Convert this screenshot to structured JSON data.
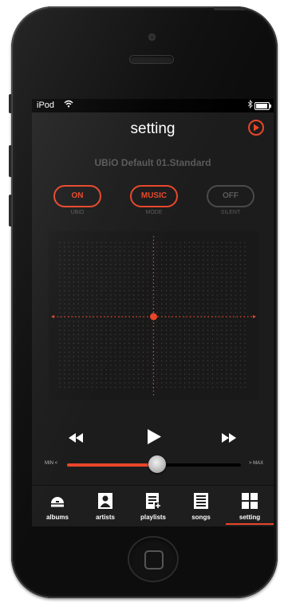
{
  "status_bar": {
    "carrier": "iPod",
    "wifi_icon": "wifi-icon",
    "bluetooth_icon": "bluetooth-icon",
    "battery_icon": "battery-icon",
    "battery_level": 0.9
  },
  "header": {
    "title": "setting",
    "play_icon": "play-circle-icon"
  },
  "preset": {
    "name": "UBiO Default 01.Standard"
  },
  "toggles": [
    {
      "label": "ON",
      "caption": "UBiO",
      "state": "active"
    },
    {
      "label": "MUSIC",
      "caption": "MODE",
      "state": "active"
    },
    {
      "label": "OFF",
      "caption": "SILENT",
      "state": "inactive"
    }
  ],
  "equalizer": {
    "x_value": 0,
    "y_value": 0,
    "grid_dots": "dotted",
    "axis_color": "#e8462a",
    "point_color": "#e8462a"
  },
  "transport": {
    "rewind_icon": "rewind-icon",
    "play_icon": "play-icon",
    "forward_icon": "fast-forward-icon"
  },
  "volume": {
    "min_label": "MIN <",
    "max_label": "> MAX",
    "level": 0.52
  },
  "tabs": [
    {
      "label": "albums",
      "icon": "albums-icon"
    },
    {
      "label": "artists",
      "icon": "artists-icon"
    },
    {
      "label": "playlists",
      "icon": "playlists-icon"
    },
    {
      "label": "songs",
      "icon": "songs-icon"
    },
    {
      "label": "setting",
      "icon": "setting-icon",
      "active": true
    }
  ],
  "colors": {
    "accent": "#e8462a",
    "background": "#1c1c1c",
    "inactive": "#5a5a5a"
  }
}
